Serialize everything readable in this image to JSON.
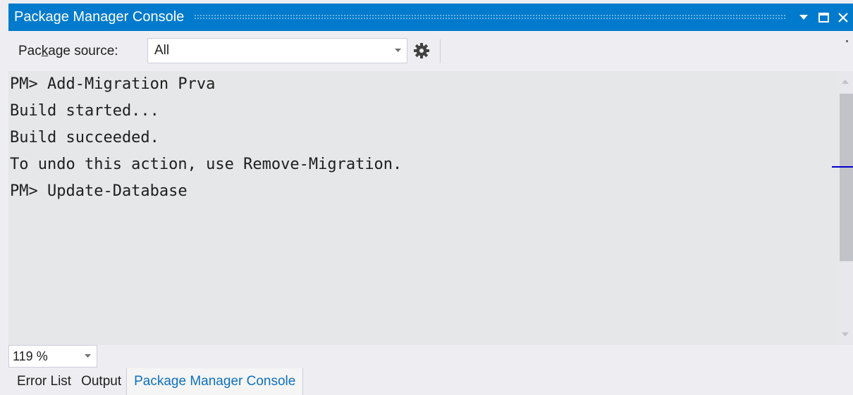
{
  "window": {
    "title": "Package Manager Console",
    "icons": [
      "dropdown-arrow-icon",
      "maximize-icon",
      "close-icon"
    ]
  },
  "toolbar": {
    "source_label_before": "Pac",
    "source_label_access": "k",
    "source_label_after": "age source:",
    "source_value": "All",
    "settings_icon": "gear-icon"
  },
  "console": {
    "lines": [
      "PM> Add-Migration Prva",
      "Build started...",
      "Build succeeded.",
      "To undo this action, use Remove-Migration.",
      "PM> Update-Database"
    ]
  },
  "zoom": {
    "value": "119 %"
  },
  "tabs": [
    {
      "label": "Error List",
      "active": false
    },
    {
      "label": "Output",
      "active": false
    },
    {
      "label": "Package Manager Console",
      "active": true
    }
  ],
  "colors": {
    "accent": "#007acc",
    "console_bg": "#e6e7e8",
    "active_tab_text": "#0e70c0",
    "scroll_marker": "#0000cd"
  }
}
